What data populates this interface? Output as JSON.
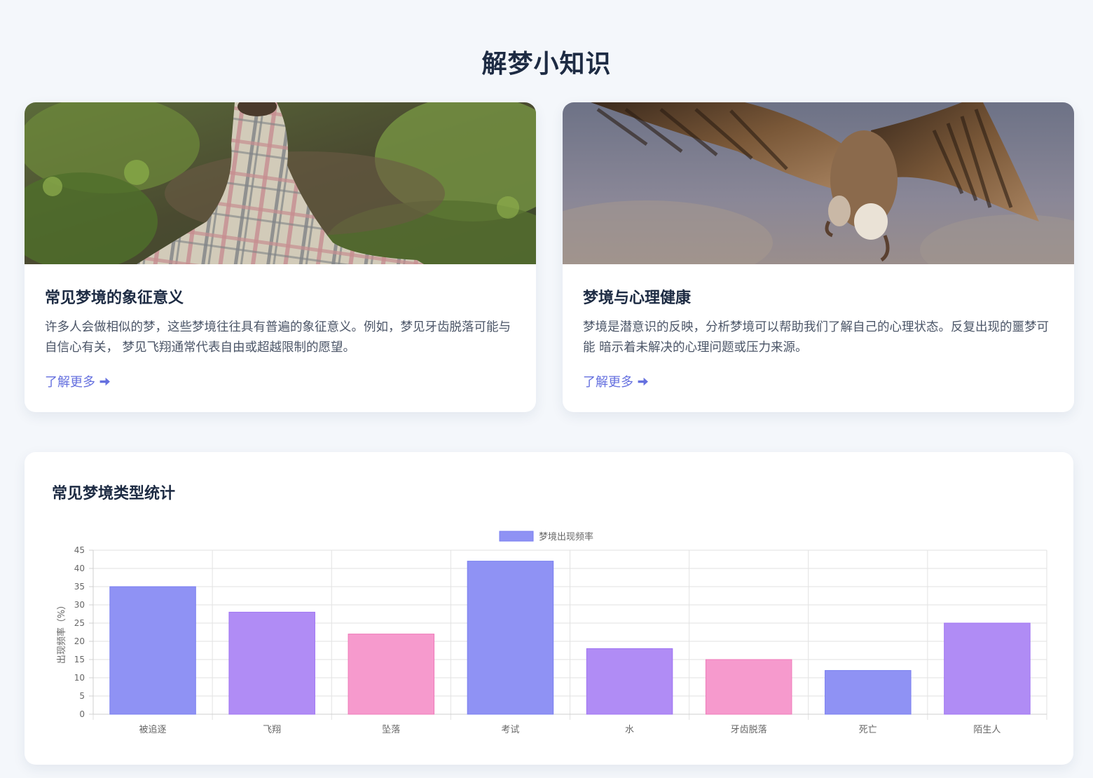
{
  "page": {
    "title": "解梦小知识"
  },
  "cards": [
    {
      "title": "常见梦境的象征意义",
      "text": "许多人会做相似的梦，这些梦境往往具有普遍的象征意义。例如，梦见牙齿脱落可能与自信心有关， 梦见飞翔通常代表自由或超越限制的愿望。",
      "link": "了解更多",
      "image": "person-in-blanket-forest-photo",
      "link_icon": "arrow-right-icon"
    },
    {
      "title": "梦境与心理健康",
      "text": "梦境是潜意识的反映，分析梦境可以帮助我们了解自己的心理状态。反复出现的噩梦可能 暗示着未解决的心理问题或压力来源。",
      "link": "了解更多",
      "image": "vulture-in-flight-photo",
      "link_icon": "arrow-right-icon"
    }
  ],
  "chart_section": {
    "title": "常见梦境类型统计"
  },
  "chart_data": {
    "type": "bar",
    "title": "",
    "categories": [
      "被追逐",
      "飞翔",
      "坠落",
      "考试",
      "水",
      "牙齿脱落",
      "死亡",
      "陌生人"
    ],
    "series": [
      {
        "name": "梦境出现频率",
        "values": [
          35,
          28,
          22,
          42,
          18,
          15,
          12,
          25
        ]
      }
    ],
    "bar_colors": [
      "#8f92f4",
      "#b08cf5",
      "#f69acd",
      "#8f92f4",
      "#b08cf5",
      "#f69acd",
      "#8f92f4",
      "#b08cf5"
    ],
    "bar_borders": [
      "#7a7ff0",
      "#9f73f2",
      "#ee7ab9",
      "#7a7ff0",
      "#9f73f2",
      "#ee7ab9",
      "#7a7ff0",
      "#9f73f2"
    ],
    "legend_color": "#8f92f4",
    "xlabel": "",
    "ylabel": "出现频率（%）",
    "ylim": [
      0,
      45
    ],
    "yticks": [
      0,
      5,
      10,
      15,
      20,
      25,
      30,
      35,
      40,
      45
    ],
    "legend_position": "top",
    "grid": true
  },
  "colors": {
    "accent": "#6570df",
    "background": "#f4f7fb"
  }
}
